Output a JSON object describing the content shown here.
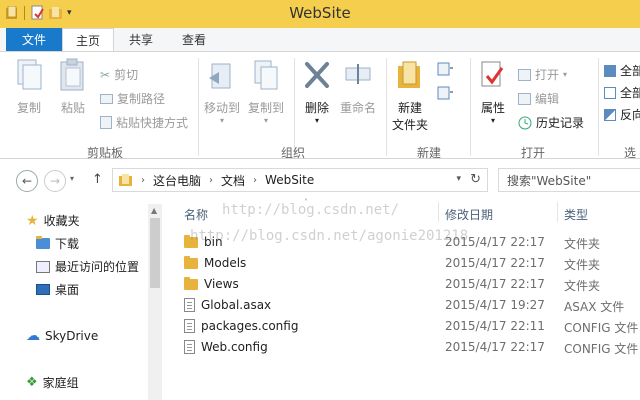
{
  "window": {
    "title": "WebSite"
  },
  "ribbon_tabs": {
    "file": "文件",
    "home": "主页",
    "share": "共享",
    "view": "查看"
  },
  "clipboard": {
    "copy": "复制",
    "paste": "粘贴",
    "cut": "剪切",
    "copy_path": "复制路径",
    "paste_shortcut": "粘贴快捷方式",
    "group": "剪贴板"
  },
  "organize": {
    "move_to": "移动到",
    "copy_to": "复制到",
    "delete": "删除",
    "rename": "重命名",
    "group": "组织"
  },
  "new": {
    "new_folder_line1": "新建",
    "new_folder_line2": "文件夹",
    "group": "新建"
  },
  "open": {
    "properties": "属性",
    "open": "打开",
    "edit": "编辑",
    "history": "历史记录",
    "group": "打开"
  },
  "select": {
    "item1": "全部",
    "item2": "全部",
    "item3": "反向",
    "group": "选"
  },
  "address": {
    "crumbs": [
      "这台电脑",
      "文档",
      "WebSite"
    ],
    "search_placeholder": "搜索\"WebSite\""
  },
  "nav_pane": {
    "favorites": "收藏夹",
    "downloads": "下载",
    "recent": "最近访问的位置",
    "desktop": "桌面",
    "skydrive": "SkyDrive",
    "homegroup": "家庭组"
  },
  "columns": {
    "name": "名称",
    "date": "修改日期",
    "type": "类型"
  },
  "files": [
    {
      "name": "bin",
      "date": "2015/4/17 22:17",
      "type": "文件夹",
      "icon": "folder-icon"
    },
    {
      "name": "Models",
      "date": "2015/4/17 22:17",
      "type": "文件夹",
      "icon": "folder-icon"
    },
    {
      "name": "Views",
      "date": "2015/4/17 22:17",
      "type": "文件夹",
      "icon": "folder-icon"
    },
    {
      "name": "Global.asax",
      "date": "2015/4/17 19:27",
      "type": "ASAX 文件",
      "icon": "file-icon"
    },
    {
      "name": "packages.config",
      "date": "2015/4/17 22:11",
      "type": "CONFIG 文件",
      "icon": "file-icon"
    },
    {
      "name": "Web.config",
      "date": "2015/4/17 22:17",
      "type": "CONFIG 文件",
      "icon": "file-icon"
    }
  ],
  "watermark": {
    "line1": "http://blog.csdn.net/",
    "line2": "http://blog.csdn.net/agonie201218"
  },
  "colors": {
    "titlebar": "#f5ce4e",
    "file_tab": "#1979ca",
    "folder": "#e8b33d"
  }
}
